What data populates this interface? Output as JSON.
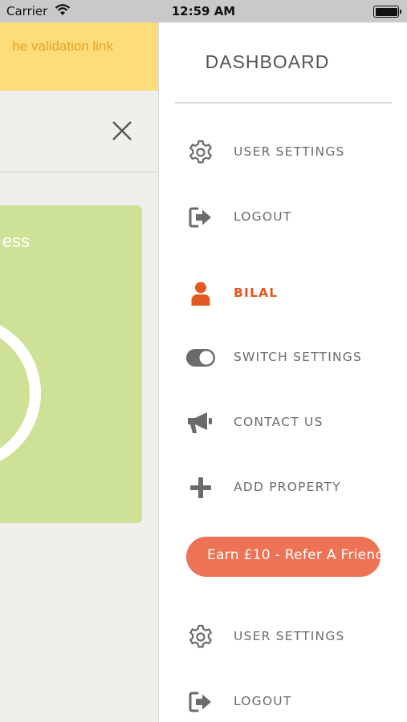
{
  "status_bar": {
    "carrier": "Carrier",
    "time": "12:59 AM"
  },
  "background_screen": {
    "banner_text": "he validation link",
    "card_text": "ess"
  },
  "drawer": {
    "title": "DASHBOARD",
    "items": [
      {
        "label": "USER SETTINGS",
        "icon": "gear-icon"
      },
      {
        "label": "LOGOUT",
        "icon": "logout-icon"
      },
      {
        "label": "BILAL",
        "icon": "user-icon",
        "active": true
      },
      {
        "label": "SWITCH SETTINGS",
        "icon": "toggle-icon"
      },
      {
        "label": "CONTACT US",
        "icon": "megaphone-icon"
      },
      {
        "label": "ADD PROPERTY",
        "icon": "plus-icon"
      }
    ],
    "refer_label": "Earn £10 - Refer A Friend",
    "bottom_items": [
      {
        "label": "USER SETTINGS",
        "icon": "gear-icon"
      },
      {
        "label": "LOGOUT",
        "icon": "logout-icon"
      }
    ]
  },
  "colors": {
    "accent": "#e25a22",
    "refer_button": "#ec7355",
    "banner": "#fddc7a",
    "banner_text": "#e5a424",
    "progress_card": "#cde296",
    "icon_grey": "#6b6b6b"
  }
}
